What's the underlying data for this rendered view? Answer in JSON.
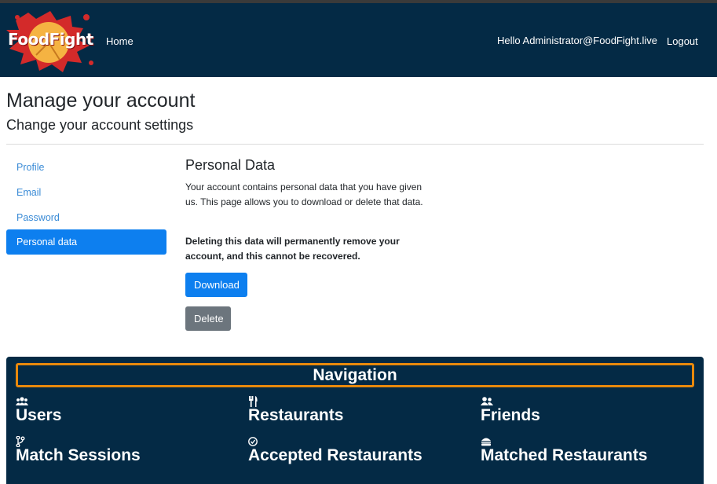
{
  "navbar": {
    "brand": "FoodFight",
    "home": "Home",
    "hello": "Hello Administrator@FoodFight.live",
    "logout": "Logout"
  },
  "page": {
    "title": "Manage your account",
    "subtitle": "Change your account settings"
  },
  "sidebar": {
    "items": [
      {
        "label": "Profile",
        "active": false
      },
      {
        "label": "Email",
        "active": false
      },
      {
        "label": "Password",
        "active": false
      },
      {
        "label": "Personal data",
        "active": true
      }
    ]
  },
  "personal_data": {
    "title": "Personal Data",
    "description": "Your account contains personal data that you have given us. This page allows you to download or delete that data.",
    "warning": "Deleting this data will permanently remove your account, and this cannot be recovered.",
    "download_label": "Download",
    "delete_label": "Delete"
  },
  "navigation": {
    "header": "Navigation",
    "items": [
      {
        "label": "Users",
        "icon": "users-icon"
      },
      {
        "label": "Restaurants",
        "icon": "utensils-icon"
      },
      {
        "label": "Friends",
        "icon": "user-friends-icon"
      },
      {
        "label": "Match Sessions",
        "icon": "code-branch-icon"
      },
      {
        "label": "Accepted Restaurants",
        "icon": "check-circle-icon"
      },
      {
        "label": "Matched Restaurants",
        "icon": "hamburger-icon"
      }
    ]
  },
  "colors": {
    "navbar_bg": "#042a45",
    "primary": "#0d7fef",
    "secondary": "#6c757d",
    "nav_header_border": "#e8890c",
    "link": "#3a8bd6"
  }
}
